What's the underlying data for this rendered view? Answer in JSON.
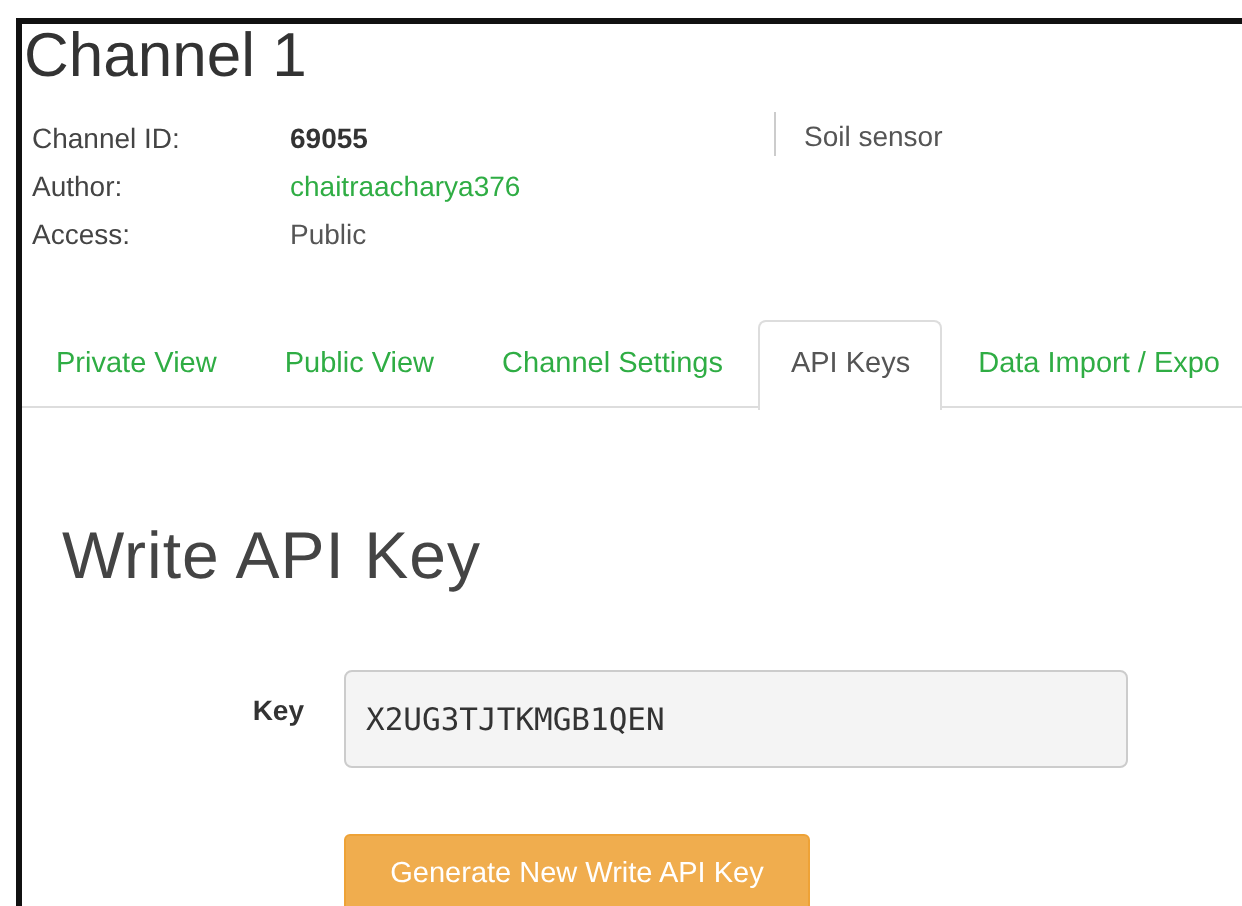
{
  "title": "Channel 1",
  "info": [
    {
      "label": "Channel ID:",
      "value": "69055",
      "kind": "bold"
    },
    {
      "label": "Author:",
      "value": "chaitraacharya376",
      "kind": "link"
    },
    {
      "label": "Access:",
      "value": "Public",
      "kind": "plain"
    }
  ],
  "description": "Soil sensor",
  "tabs": [
    {
      "label": "Private View",
      "selected": false
    },
    {
      "label": "Public View",
      "selected": false
    },
    {
      "label": "Channel Settings",
      "selected": false
    },
    {
      "label": "API Keys",
      "selected": true
    },
    {
      "label": "Data Import / Expo",
      "selected": false
    }
  ],
  "section": {
    "heading": "Write API Key",
    "key_label": "Key",
    "key_value": "X2UG3TJTKMGB1QEN",
    "button": "Generate New Write API Key"
  }
}
